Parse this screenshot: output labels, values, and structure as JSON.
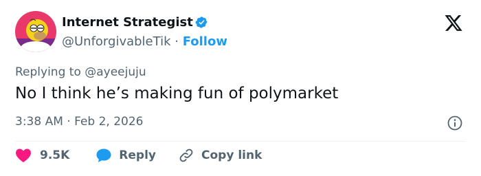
{
  "user": {
    "display_name": "Internet Strategist",
    "handle": "@UnforgivableTik",
    "separator": "·",
    "follow_label": "Follow",
    "verified": true
  },
  "tweet": {
    "replying_prefix": "Replying to",
    "replying_handle": "@ayeejuju",
    "text": "No I think he’s making fun of polymarket",
    "time": "3:38 AM",
    "separator": "·",
    "date": "Feb 2, 2026"
  },
  "actions": {
    "like_count": "9.5K",
    "reply_label": "Reply",
    "copy_label": "Copy link"
  },
  "icons": {
    "brand": "x-logo-icon",
    "verified": "verified-badge-icon",
    "like": "heart-icon",
    "reply": "speech-bubble-icon",
    "copy": "link-icon",
    "info": "info-icon"
  },
  "colors": {
    "accent": "#1d9bf0",
    "like": "#f91880",
    "text": "#0f1419",
    "muted": "#536471",
    "avatar_bg": "#e8396a"
  }
}
